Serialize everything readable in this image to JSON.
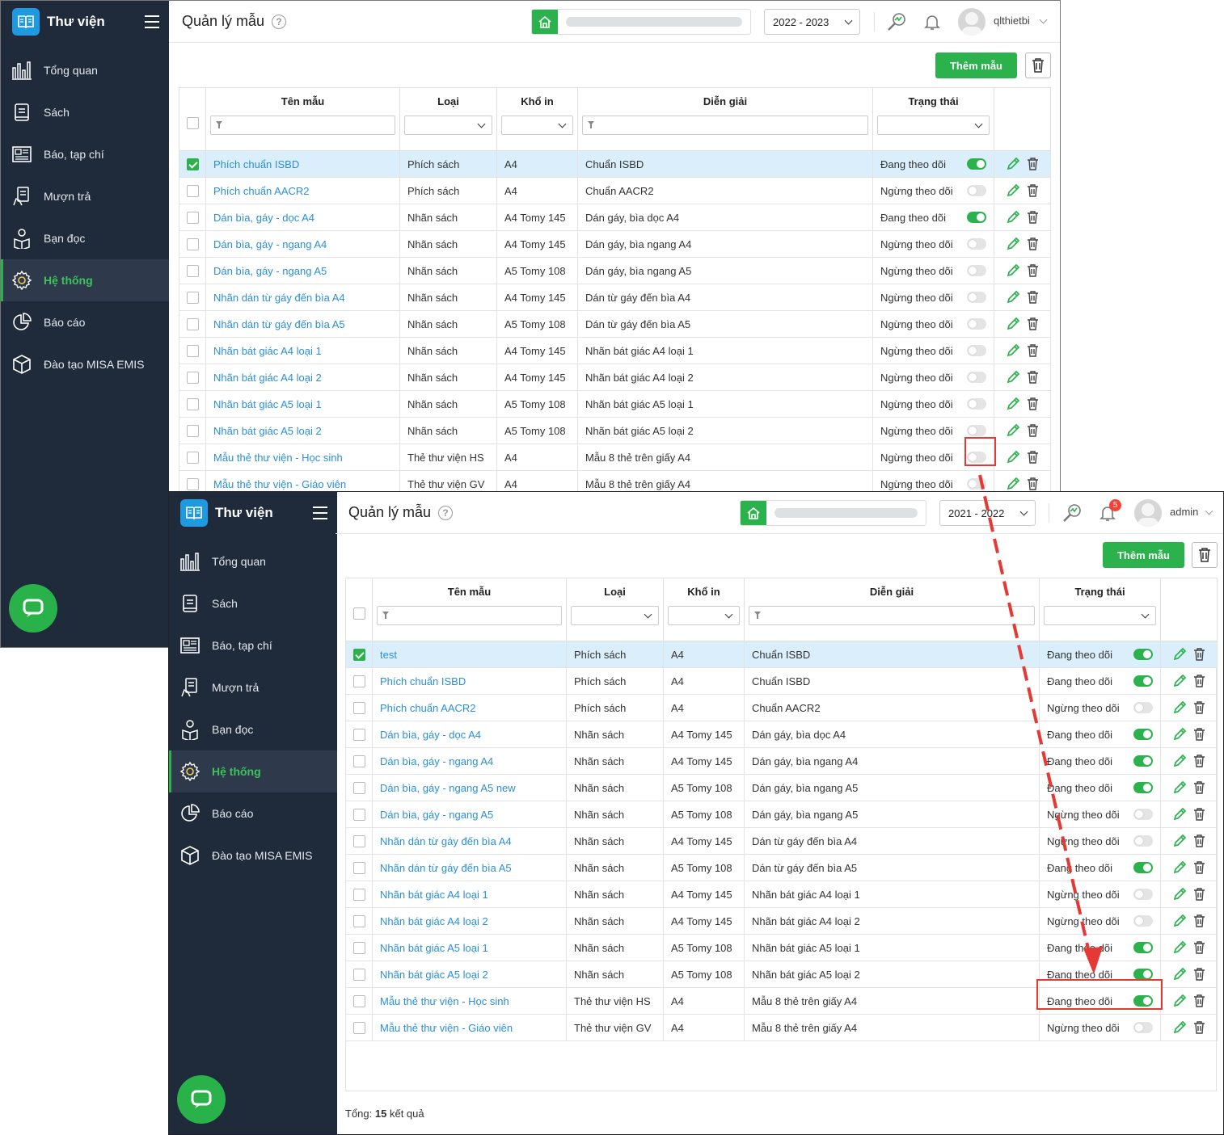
{
  "colors": {
    "sidebar": "#1f2a3b",
    "accent": "#2bb24c",
    "link": "#2b8fd6",
    "highlight": "#e53935"
  },
  "app": {
    "name": "Thư viện"
  },
  "menu": [
    {
      "label": "Tổng quan",
      "icon": "bar-chart-icon"
    },
    {
      "label": "Sách",
      "icon": "book-icon"
    },
    {
      "label": "Báo, tạp chí",
      "icon": "newspaper-icon"
    },
    {
      "label": "Mượn trả",
      "icon": "borrow-icon"
    },
    {
      "label": "Bạn đọc",
      "icon": "reader-icon"
    },
    {
      "label": "Hệ thống",
      "icon": "gear-icon",
      "active": true
    },
    {
      "label": "Báo cáo",
      "icon": "pie-chart-icon"
    },
    {
      "label": "Đào tạo MISA EMIS",
      "icon": "cube-icon"
    }
  ],
  "page": {
    "title": "Quản lý mẫu",
    "add_label": "Thêm mẫu"
  },
  "columns": [
    "Tên mẫu",
    "Loại",
    "Khổ in",
    "Diễn giải",
    "Trạng thái"
  ],
  "shot1": {
    "year": "2022 - 2023",
    "user": "qlthietbi",
    "rows": [
      {
        "name": "Phích chuẩn ISBD",
        "type": "Phích sách",
        "size": "A4",
        "desc": "Chuẩn ISBD",
        "status": "Đang theo dõi",
        "on": true,
        "checked": true
      },
      {
        "name": "Phích chuẩn AACR2",
        "type": "Phích sách",
        "size": "A4",
        "desc": "Chuẩn AACR2",
        "status": "Ngừng theo dõi",
        "on": false
      },
      {
        "name": "Dán bìa, gáy - dọc A4",
        "type": "Nhãn sách",
        "size": "A4 Tomy 145",
        "desc": "Dán gáy, bìa dọc A4",
        "status": "Đang theo dõi",
        "on": true
      },
      {
        "name": "Dán bìa, gáy - ngang A4",
        "type": "Nhãn sách",
        "size": "A4 Tomy 145",
        "desc": "Dán gáy, bìa ngang A4",
        "status": "Ngừng theo dõi",
        "on": false
      },
      {
        "name": "Dán bìa, gáy - ngang A5",
        "type": "Nhãn sách",
        "size": "A5 Tomy 108",
        "desc": "Dán gáy, bìa ngang A5",
        "status": "Ngừng theo dõi",
        "on": false
      },
      {
        "name": "Nhãn dán từ gáy đến bìa A4",
        "type": "Nhãn sách",
        "size": "A4 Tomy 145",
        "desc": "Dán từ gáy đến bìa A4",
        "status": "Ngừng theo dõi",
        "on": false
      },
      {
        "name": "Nhãn dán từ gáy đến bìa A5",
        "type": "Nhãn sách",
        "size": "A5 Tomy 108",
        "desc": "Dán từ gáy đến bìa A5",
        "status": "Ngừng theo dõi",
        "on": false
      },
      {
        "name": "Nhãn bát giác A4 loại 1",
        "type": "Nhãn sách",
        "size": "A4 Tomy 145",
        "desc": "Nhãn bát giác A4 loại 1",
        "status": "Ngừng theo dõi",
        "on": false
      },
      {
        "name": "Nhãn bát giác A4 loại 2",
        "type": "Nhãn sách",
        "size": "A4 Tomy 145",
        "desc": "Nhãn bát giác A4 loại 2",
        "status": "Ngừng theo dõi",
        "on": false
      },
      {
        "name": "Nhãn bát giác A5 loại 1",
        "type": "Nhãn sách",
        "size": "A5 Tomy 108",
        "desc": "Nhãn bát giác A5 loại 1",
        "status": "Ngừng theo dõi",
        "on": false
      },
      {
        "name": "Nhãn bát giác A5 loại 2",
        "type": "Nhãn sách",
        "size": "A5 Tomy 108",
        "desc": "Nhãn bát giác A5 loại 2",
        "status": "Ngừng theo dõi",
        "on": false
      },
      {
        "name": "Mẫu thẻ thư viện - Học sinh",
        "type": "Thẻ thư viện HS",
        "size": "A4",
        "desc": "Mẫu 8 thẻ trên giấy A4",
        "status": "Ngừng theo dõi",
        "on": false
      },
      {
        "name": "Mẫu thẻ thư viện - Giáo viên",
        "type": "Thẻ thư viện GV",
        "size": "A4",
        "desc": "Mẫu 8 thẻ trên giấy A4",
        "status": "Ngừng theo dõi",
        "on": false
      }
    ]
  },
  "shot2": {
    "year": "2021 - 2022",
    "user": "admin",
    "notifications": "5",
    "total_prefix": "Tổng:",
    "total_count": "15",
    "total_suffix": "kết quả",
    "rows": [
      {
        "name": "test",
        "type": "Phích sách",
        "size": "A4",
        "desc": "Chuẩn ISBD",
        "status": "Đang theo dõi",
        "on": true,
        "checked": true
      },
      {
        "name": "Phích chuẩn ISBD",
        "type": "Phích sách",
        "size": "A4",
        "desc": "Chuẩn ISBD",
        "status": "Đang theo dõi",
        "on": true
      },
      {
        "name": "Phích chuẩn AACR2",
        "type": "Phích sách",
        "size": "A4",
        "desc": "Chuẩn AACR2",
        "status": "Ngừng theo dõi",
        "on": false
      },
      {
        "name": "Dán bìa, gáy - dọc A4",
        "type": "Nhãn sách",
        "size": "A4 Tomy 145",
        "desc": "Dán gáy, bìa dọc A4",
        "status": "Đang theo dõi",
        "on": true
      },
      {
        "name": "Dán bìa, gáy - ngang A4",
        "type": "Nhãn sách",
        "size": "A4 Tomy 145",
        "desc": "Dán gáy, bìa ngang A4",
        "status": "Đang theo dõi",
        "on": true
      },
      {
        "name": "Dán bìa, gáy - ngang A5 new",
        "type": "Nhãn sách",
        "size": "A5 Tomy 108",
        "desc": "Dán gáy, bìa ngang A5",
        "status": "Đang theo dõi",
        "on": true
      },
      {
        "name": "Dán bìa, gáy - ngang A5",
        "type": "Nhãn sách",
        "size": "A5 Tomy 108",
        "desc": "Dán gáy, bìa ngang A5",
        "status": "Ngừng theo dõi",
        "on": false
      },
      {
        "name": "Nhãn dán từ gáy đến bìa A4",
        "type": "Nhãn sách",
        "size": "A4 Tomy 145",
        "desc": "Dán từ gáy đến bìa A4",
        "status": "Ngừng theo dõi",
        "on": false
      },
      {
        "name": "Nhãn dán từ gáy đến bìa A5",
        "type": "Nhãn sách",
        "size": "A5 Tomy 108",
        "desc": "Dán từ gáy đến bìa A5",
        "status": "Đang theo dõi",
        "on": true
      },
      {
        "name": "Nhãn bát giác A4 loại 1",
        "type": "Nhãn sách",
        "size": "A4 Tomy 145",
        "desc": "Nhãn bát giác A4 loại 1",
        "status": "Ngừng theo dõi",
        "on": false
      },
      {
        "name": "Nhãn bát giác A4 loại 2",
        "type": "Nhãn sách",
        "size": "A4 Tomy 145",
        "desc": "Nhãn bát giác A4 loại 2",
        "status": "Ngừng theo dõi",
        "on": false
      },
      {
        "name": "Nhãn bát giác A5 loại 1",
        "type": "Nhãn sách",
        "size": "A5 Tomy 108",
        "desc": "Nhãn bát giác A5 loại 1",
        "status": "Đang theo dõi",
        "on": true
      },
      {
        "name": "Nhãn bát giác A5 loại 2",
        "type": "Nhãn sách",
        "size": "A5 Tomy 108",
        "desc": "Nhãn bát giác A5 loại 2",
        "status": "Đang theo dõi",
        "on": true
      },
      {
        "name": "Mẫu thẻ thư viện - Học sinh",
        "type": "Thẻ thư viện HS",
        "size": "A4",
        "desc": "Mẫu 8 thẻ trên giấy A4",
        "status": "Đang theo dõi",
        "on": true
      },
      {
        "name": "Mẫu thẻ thư viện - Giáo viên",
        "type": "Thẻ thư viện GV",
        "size": "A4",
        "desc": "Mẫu 8 thẻ trên giấy A4",
        "status": "Ngừng theo dõi",
        "on": false
      }
    ]
  }
}
